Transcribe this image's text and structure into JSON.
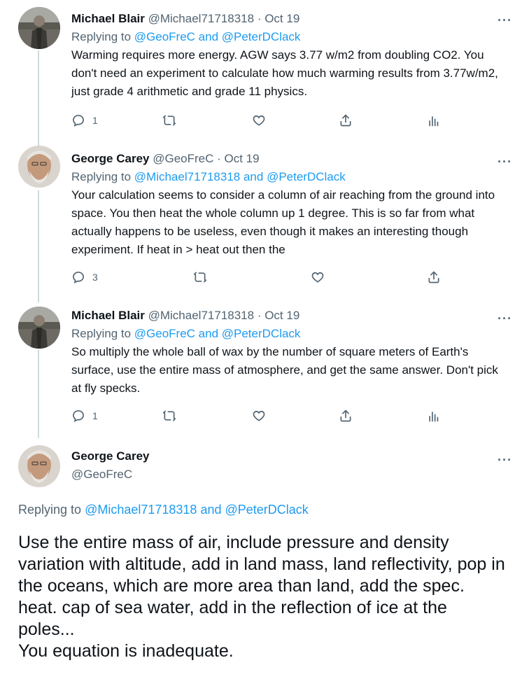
{
  "tweets": [
    {
      "name": "Michael Blair",
      "handle": "@Michael71718318",
      "sep": " · ",
      "date": "Oct 19",
      "replying_prefix": "Replying to ",
      "replying_to": "@GeoFreC and @PeterDClack",
      "body": "Warming requires more energy. AGW says 3.77 w/m2 from doubling CO2. You don't need an experiment to calculate how much warming results from 3.77w/m2, just grade 4 arithmetic and grade 11 physics.",
      "reply_count": "1",
      "more": "···"
    },
    {
      "name": "George Carey",
      "handle": "@GeoFreC",
      "sep": " · ",
      "date": "Oct 19",
      "replying_prefix": "Replying to ",
      "replying_to": "@Michael71718318 and @PeterDClack",
      "body": "Your calculation seems to consider a column of air reaching from the ground into space. You then heat the whole column up 1 degree. This is so far from what actually happens to be useless, even though it makes an interesting though experiment. If heat in > heat out then the",
      "reply_count": "3",
      "more": "···"
    },
    {
      "name": "Michael Blair",
      "handle": "@Michael71718318",
      "sep": " · ",
      "date": "Oct 19",
      "replying_prefix": "Replying to ",
      "replying_to": "@GeoFreC and @PeterDClack",
      "body": "So multiply the whole ball of wax by the number of square meters of Earth's surface, use the entire mass of atmosphere, and get the same answer. Don't pick at fly specks.",
      "reply_count": "1",
      "more": "···"
    }
  ],
  "main": {
    "name": "George Carey",
    "handle": "@GeoFreC",
    "more": "···",
    "replying_prefix": "Replying to ",
    "replying_to": "@Michael71718318 and @PeterDClack",
    "body_line1": "Use the entire mass of air, include pressure and density variation with altitude, add in land mass, land reflectivity, pop in the oceans, which are more area than land, add the spec. heat. cap of sea water, add in the reflection of ice at the poles...",
    "body_line2": "You equation is inadequate."
  },
  "icons": [
    "reply-icon",
    "retweet-icon",
    "like-icon",
    "share-icon",
    "analytics-icon",
    "more-icon"
  ],
  "colors": {
    "link": "#1d9bf0",
    "muted": "#536471",
    "text": "#0f1419",
    "thread_line": "#cfd9de"
  }
}
